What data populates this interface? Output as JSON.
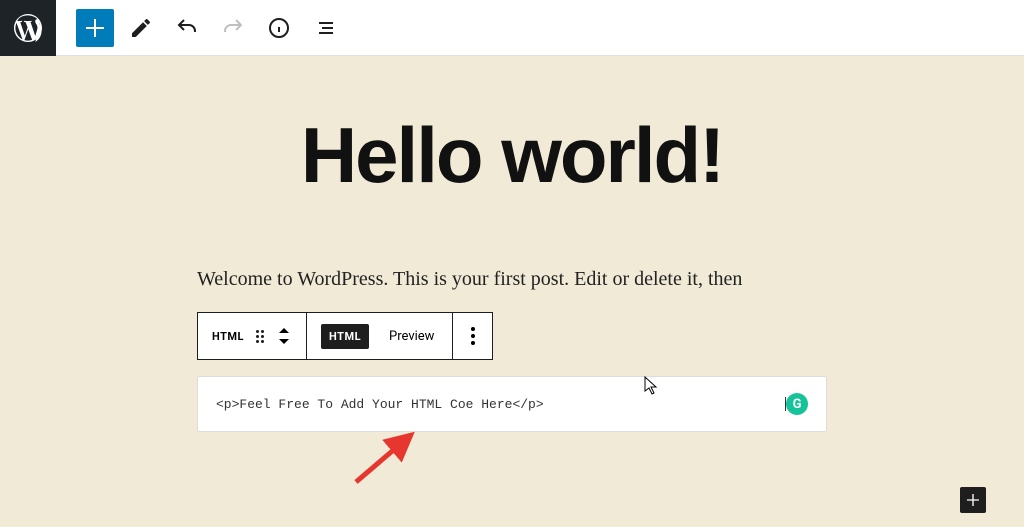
{
  "post": {
    "title": "Hello world!",
    "paragraph": "Welcome to WordPress. This is your first post. Edit or delete it, then"
  },
  "block_toolbar": {
    "type_label": "HTML",
    "html_button": "HTML",
    "preview_button": "Preview"
  },
  "html_block": {
    "code": "<p>Feel Free To Add Your HTML Coe Here</p>"
  },
  "grammarly": {
    "glyph": "G"
  }
}
